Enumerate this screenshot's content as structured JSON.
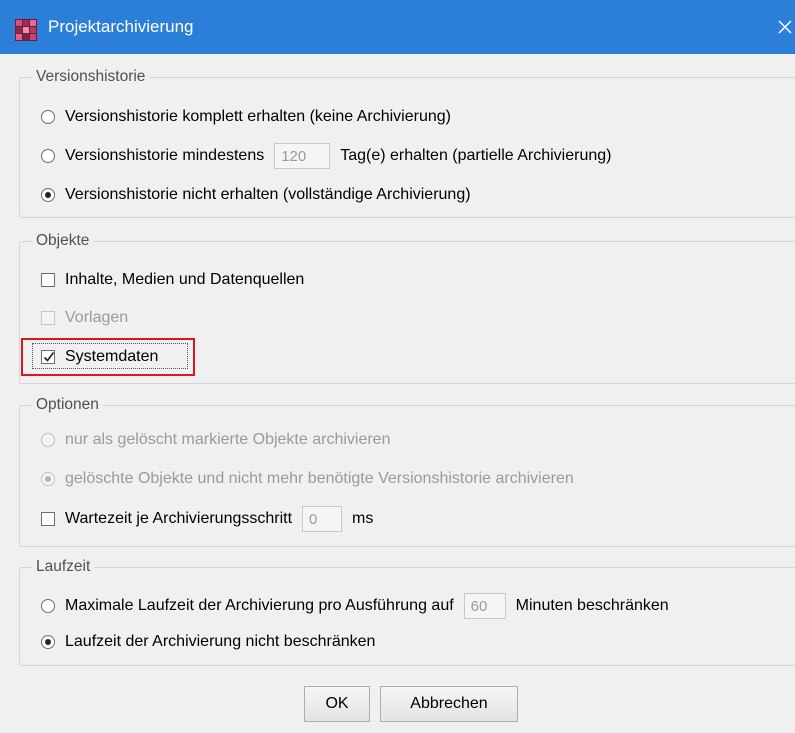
{
  "window": {
    "title": "Projektarchivierung",
    "close_glyph": "✕",
    "accent": "#2b7fd9"
  },
  "version_history": {
    "label": "Versionshistorie",
    "options": [
      {
        "label": "Versionshistorie komplett erhalten (keine Archivierung)",
        "checked": false
      },
      {
        "label_before": "Versionshistorie mindestens",
        "days_value": "120",
        "label_after": "Tag(e) erhalten (partielle Archivierung)",
        "checked": false
      },
      {
        "label": "Versionshistorie nicht erhalten (vollständige Archivierung)",
        "checked": true
      }
    ]
  },
  "objects": {
    "label": "Objekte",
    "items": [
      {
        "label": "Inhalte, Medien und Datenquellen",
        "checked": false,
        "enabled": true
      },
      {
        "label": "Vorlagen",
        "checked": false,
        "enabled": false
      },
      {
        "label": "Systemdaten",
        "checked": true,
        "enabled": true,
        "highlighted": true
      }
    ]
  },
  "options": {
    "label": "Optionen",
    "radios": [
      {
        "label": "nur als gelöscht markierte Objekte archivieren",
        "checked": false,
        "enabled": false
      },
      {
        "label": "gelöschte Objekte und nicht mehr benötigte Versionshistorie archivieren",
        "checked": true,
        "enabled": false
      }
    ],
    "wait": {
      "label": "Wartezeit je Archivierungsschritt",
      "value": "0",
      "unit": "ms",
      "checked": false
    }
  },
  "runtime": {
    "label": "Laufzeit",
    "limit": {
      "label_before": "Maximale Laufzeit der Archivierung pro Ausführung auf",
      "value": "60",
      "label_after": "Minuten beschränken",
      "checked": false
    },
    "no_limit": {
      "label": "Laufzeit der Archivierung nicht beschränken",
      "checked": true
    }
  },
  "buttons": {
    "ok": "OK",
    "cancel": "Abbrechen"
  },
  "colors": {
    "highlight_border": "#e0141e",
    "disabled_text": "#9a9a9a"
  }
}
